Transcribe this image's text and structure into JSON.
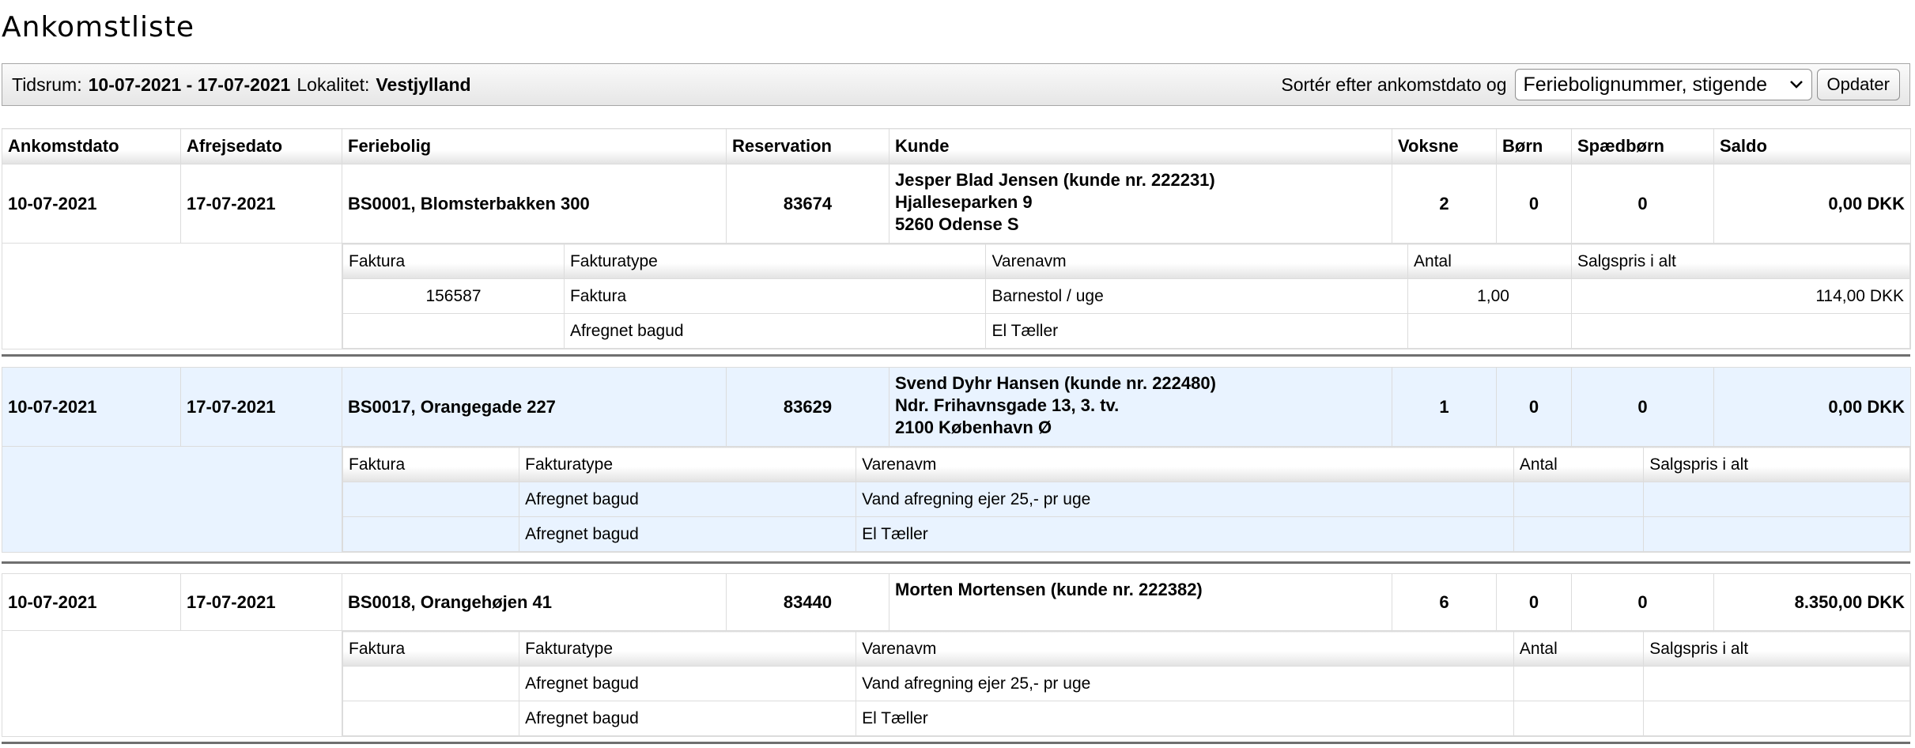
{
  "page": {
    "title": "Ankomstliste"
  },
  "filter": {
    "tidsrum_label": "Tidsrum:",
    "tidsrum_value": "10-07-2021 - 17-07-2021",
    "lokalitet_label": "Lokalitet:",
    "lokalitet_value": "Vestjylland",
    "sort_label": "Sortér efter ankomstdato og",
    "sort_value": "Feriebolignummer, stigende",
    "update_label": "Opdater"
  },
  "columns": [
    "Ankomstdato",
    "Afrejsedato",
    "Feriebolig",
    "Reservation",
    "Kunde",
    "Voksne",
    "Børn",
    "Spædbørn",
    "Saldo"
  ],
  "sub_columns": [
    "Faktura",
    "Fakturatype",
    "Varenavm",
    "Antal",
    "Salgspris i alt"
  ],
  "reservations": [
    {
      "ankomst": "10-07-2021",
      "afrejse": "17-07-2021",
      "feriebolig": "BS0001, Blomsterbakken 300",
      "reservation": "83674",
      "kunde": [
        "Jesper Blad Jensen (kunde nr. 222231)",
        "Hjalleseparken 9",
        "5260 Odense S"
      ],
      "voksne": "2",
      "born": "0",
      "spaedborn": "0",
      "saldo": "0,00 DKK",
      "lines": [
        {
          "faktura": "156587",
          "type": "Faktura",
          "varenavn": "Barnestol / uge",
          "antal": "1,00",
          "pris": "114,00 DKK"
        },
        {
          "faktura": "",
          "type": "Afregnet bagud",
          "varenavn": "El Tæller",
          "antal": "",
          "pris": ""
        }
      ]
    },
    {
      "ankomst": "10-07-2021",
      "afrejse": "17-07-2021",
      "feriebolig": "BS0017, Orangegade 227",
      "reservation": "83629",
      "kunde": [
        "Svend Dyhr Hansen (kunde nr. 222480)",
        "Ndr. Frihavnsgade 13, 3. tv.",
        "2100 København Ø"
      ],
      "voksne": "1",
      "born": "0",
      "spaedborn": "0",
      "saldo": "0,00 DKK",
      "lines": [
        {
          "faktura": "",
          "type": "Afregnet bagud",
          "varenavn": "Vand afregning ejer 25,- pr uge",
          "antal": "",
          "pris": ""
        },
        {
          "faktura": "",
          "type": "Afregnet bagud",
          "varenavn": "El Tæller",
          "antal": "",
          "pris": ""
        }
      ]
    },
    {
      "ankomst": "10-07-2021",
      "afrejse": "17-07-2021",
      "feriebolig": "BS0018, Orangehøjen 41",
      "reservation": "83440",
      "kunde": [
        "Morten Mortensen (kunde nr. 222382)",
        "",
        ""
      ],
      "voksne": "6",
      "born": "0",
      "spaedborn": "0",
      "saldo": "8.350,00 DKK",
      "lines": [
        {
          "faktura": "",
          "type": "Afregnet bagud",
          "varenavn": "Vand afregning ejer 25,- pr uge",
          "antal": "",
          "pris": ""
        },
        {
          "faktura": "",
          "type": "Afregnet bagud",
          "varenavn": "El Tæller",
          "antal": "",
          "pris": ""
        }
      ]
    }
  ]
}
